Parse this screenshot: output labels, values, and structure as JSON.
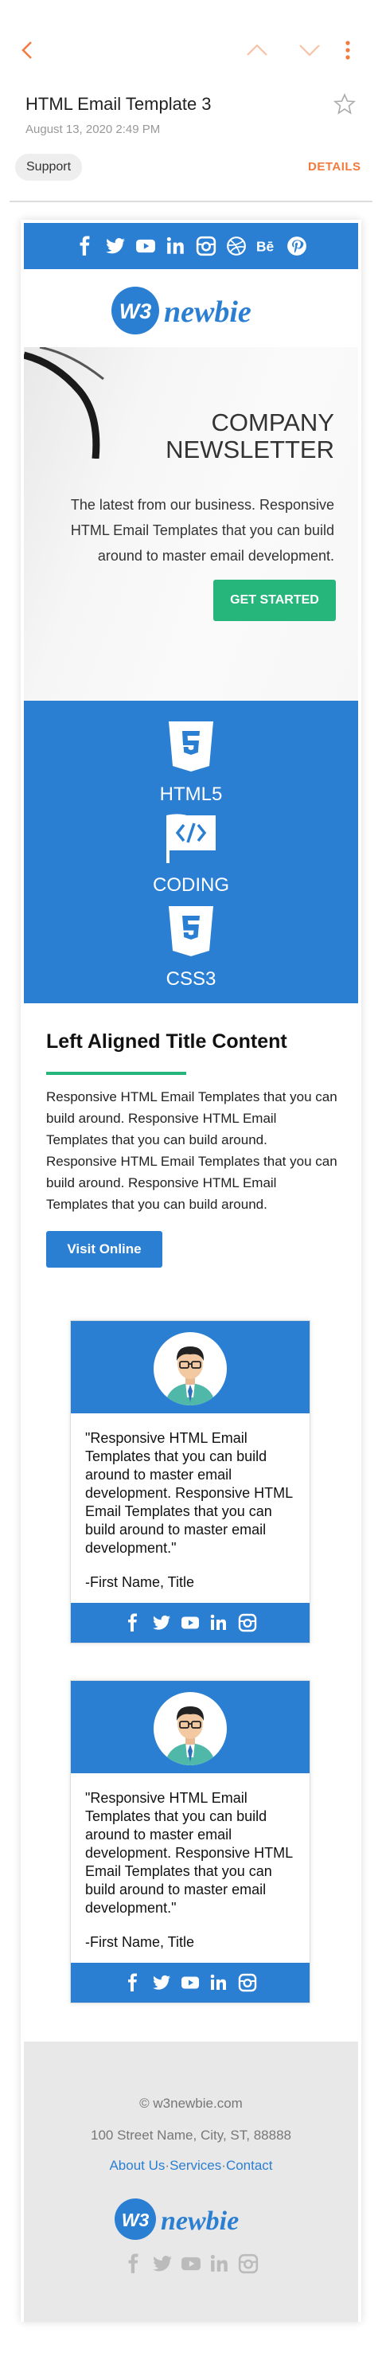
{
  "colors": {
    "accent": "#f37a3e",
    "brand_blue": "#2b7fd3",
    "brand_green": "#26b57a"
  },
  "toolbar": {
    "back_icon": "chevron-left-icon",
    "prev_icon": "chevron-up-icon",
    "next_icon": "chevron-down-icon",
    "more_icon": "more-vertical-icon"
  },
  "message": {
    "subject": "HTML Email Template 3",
    "date": "August 13, 2020  2:49 PM",
    "label": "Support",
    "details": "DETAILS",
    "star_icon": "star-outline-icon"
  },
  "email": {
    "social_icons": [
      "facebook-icon",
      "twitter-icon",
      "youtube-icon",
      "linkedin-icon",
      "instagram-icon",
      "dribbble-icon",
      "behance-icon",
      "pinterest-icon"
    ],
    "logo": {
      "mark": "W3",
      "word": "newbie"
    },
    "hero": {
      "title_line1": "COMPANY",
      "title_line2": "NEWSLETTER",
      "text": "The latest from our business. Responsive HTML Email Templates that you can build around to master email development.",
      "button": "GET STARTED"
    },
    "features": [
      {
        "icon": "html5-icon",
        "label": "HTML5"
      },
      {
        "icon": "coding-flag-icon",
        "label": "CODING"
      },
      {
        "icon": "css3-icon",
        "label": "CSS3"
      }
    ],
    "content": {
      "title": "Left Aligned Title Content",
      "body": "Responsive HTML Email Templates that you can build around. Responsive HTML Email Templates that you can build around. Responsive HTML Email Templates that you can build around. Responsive HTML Email Templates that you can build around.",
      "button": "Visit Online"
    },
    "testimonials": [
      {
        "quote": "\"Responsive HTML Email Templates that you can build around to master email development. Responsive HTML Email Templates that you can build around to master email development.\"",
        "author": "-First Name, Title"
      },
      {
        "quote": "\"Responsive HTML Email Templates that you can build around to master email development. Responsive HTML Email Templates that you can build around to master email development.\"",
        "author": "-First Name, Title"
      }
    ],
    "card_social_icons": [
      "facebook-icon",
      "twitter-icon",
      "youtube-icon",
      "linkedin-icon",
      "instagram-icon"
    ],
    "footer": {
      "copyright": "© w3newbie.com",
      "address": "100 Street Name, City, ST, 88888",
      "link_about": "About Us",
      "link_services": "Services",
      "link_contact": "Contact",
      "separator": "·"
    }
  }
}
